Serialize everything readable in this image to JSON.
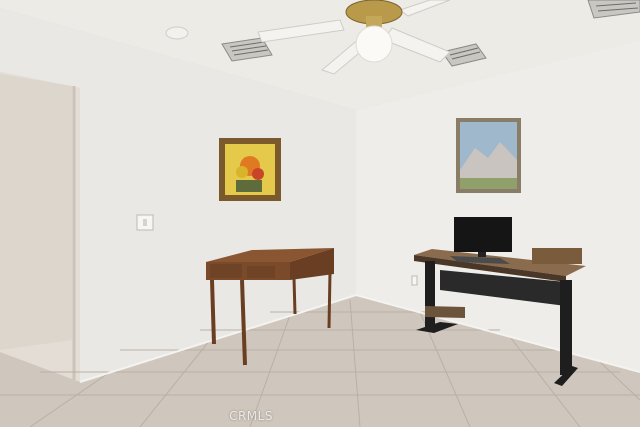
{
  "scene": {
    "description_labels": [],
    "watermark": "CRMLS"
  },
  "colors": {
    "ceiling": "#ecebe6",
    "wall_left": "#e9e8e4",
    "wall_right": "#eeede9",
    "floor_tile": "#cfc7bd",
    "grout": "#b9b0a5",
    "wood": "#7a4a2b",
    "black_desk_frame": "#1e1e1e",
    "monitor": "#151515"
  },
  "icons": [
    "ceiling-fan-icon",
    "air-vent-icon",
    "light-switch-icon",
    "outlet-icon"
  ]
}
